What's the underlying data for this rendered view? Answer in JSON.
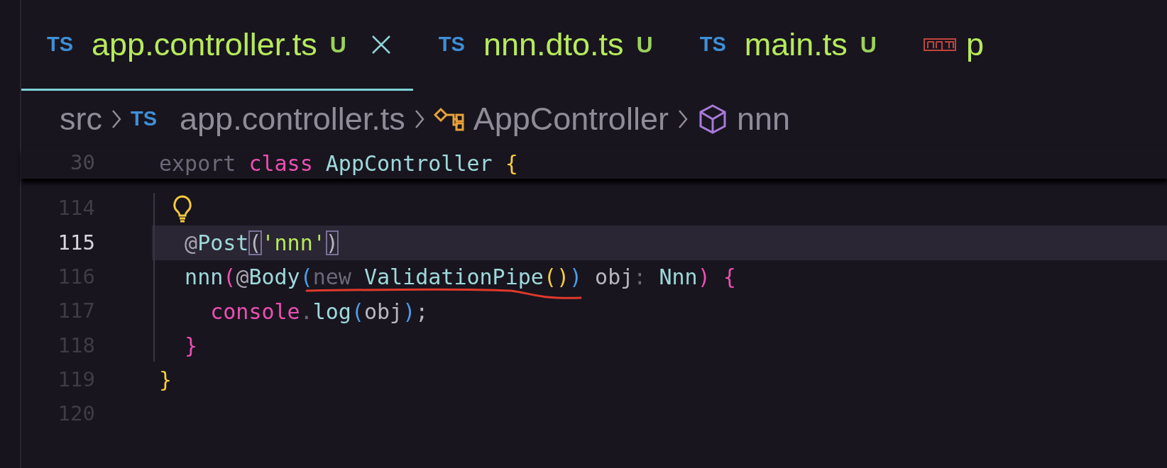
{
  "tabs": [
    {
      "kind": "ts",
      "icon_text": "TS",
      "label": "app.controller.ts",
      "badge": "U",
      "selected": true
    },
    {
      "kind": "ts",
      "icon_text": "TS",
      "label": "nnn.dto.ts",
      "badge": "U",
      "selected": false
    },
    {
      "kind": "ts",
      "icon_text": "TS",
      "label": "main.ts",
      "badge": "U",
      "selected": false
    },
    {
      "kind": "npm",
      "label": "p",
      "selected": false
    }
  ],
  "breadcrumbs": [
    {
      "kind": "folder",
      "label": "src"
    },
    {
      "kind": "ts",
      "icon_text": "TS",
      "label": "app.controller.ts"
    },
    {
      "kind": "class",
      "label": "AppController"
    },
    {
      "kind": "method",
      "label": "nnn"
    }
  ],
  "sticky_line": {
    "number": "30",
    "tokens": [
      {
        "kind": "dim",
        "text": "export "
      },
      {
        "kind": "keyword",
        "text": "class "
      },
      {
        "kind": "type",
        "text": "AppController "
      },
      {
        "kind": "brace",
        "text": "{"
      }
    ]
  },
  "lines": [
    {
      "number": "114",
      "current": false,
      "lightbulb": true
    },
    {
      "number": "115",
      "current": true,
      "lightbulb": false,
      "tokens": [
        {
          "kind": "decorator",
          "text": "  @"
        },
        {
          "kind": "type",
          "text": "Post"
        },
        {
          "kind": "matched",
          "text": "("
        },
        {
          "kind": "string",
          "text": "'nnn'"
        },
        {
          "kind": "matched",
          "text": ")"
        }
      ]
    },
    {
      "number": "116",
      "current": false,
      "lightbulb": false,
      "tokens": [
        {
          "kind": "type",
          "text": "  nnn"
        },
        {
          "kind": "keyword",
          "text": "("
        },
        {
          "kind": "decorator",
          "text": "@"
        },
        {
          "kind": "type",
          "text": "Body"
        },
        {
          "kind": "paren",
          "text": "("
        },
        {
          "kind": "dim",
          "text": "new "
        },
        {
          "kind": "type",
          "text": "ValidationPipe"
        },
        {
          "kind": "brace",
          "text": "()"
        },
        {
          "kind": "paren",
          "text": ")"
        },
        {
          "kind": "plain",
          "text": " obj"
        },
        {
          "kind": "dim",
          "text": ": "
        },
        {
          "kind": "type",
          "text": "Nnn"
        },
        {
          "kind": "keyword",
          "text": ") {"
        }
      ]
    },
    {
      "number": "117",
      "current": false,
      "lightbulb": false,
      "tokens": [
        {
          "kind": "keyword",
          "text": "    console"
        },
        {
          "kind": "dim",
          "text": "."
        },
        {
          "kind": "type",
          "text": "log"
        },
        {
          "kind": "paren",
          "text": "("
        },
        {
          "kind": "plain",
          "text": "obj"
        },
        {
          "kind": "paren",
          "text": ")"
        },
        {
          "kind": "plain",
          "text": ";"
        }
      ]
    },
    {
      "number": "118",
      "current": false,
      "lightbulb": false,
      "tokens": [
        {
          "kind": "keyword",
          "text": "  }"
        }
      ]
    },
    {
      "number": "119",
      "current": false,
      "lightbulb": false,
      "tokens": [
        {
          "kind": "brace",
          "text": "}"
        }
      ]
    },
    {
      "number": "120",
      "current": false,
      "lightbulb": false
    }
  ]
}
